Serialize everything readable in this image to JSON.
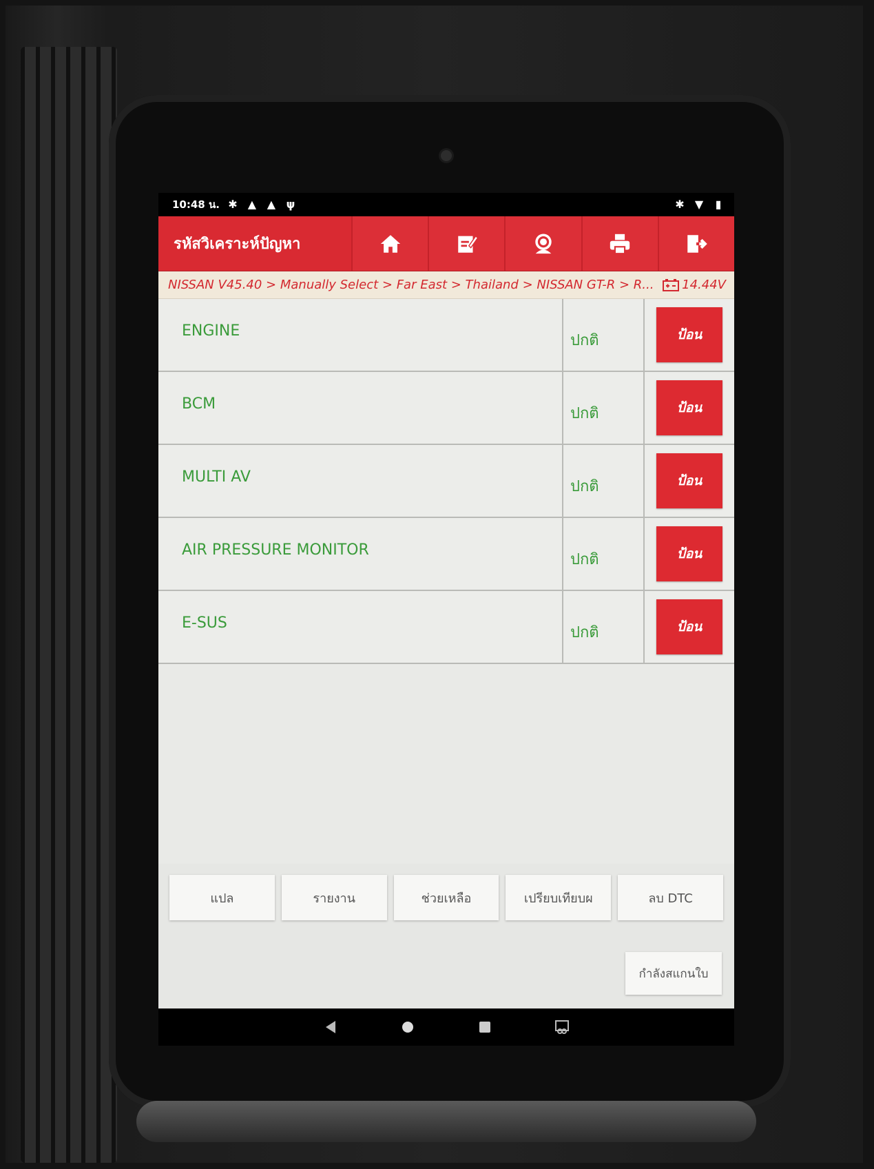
{
  "status_bar": {
    "time": "10:48 น.",
    "icons": [
      "bluetooth-icon",
      "warning-icon",
      "warning-icon",
      "usb-icon",
      "wifi-icon",
      "battery-icon"
    ]
  },
  "header": {
    "title": "รหัสวิเคราะห์ปัญหา",
    "toolbar": [
      "home-icon",
      "edit-icon",
      "support-icon",
      "print-icon",
      "exit-icon"
    ]
  },
  "breadcrumb": {
    "path": "NISSAN V45.40 > Manually Select > Far East > Thailand > NISSAN GT-R > R...",
    "voltage": "14.44V"
  },
  "systems": [
    {
      "name": "ENGINE",
      "status": "ปกติ",
      "action": "ป้อน"
    },
    {
      "name": "BCM",
      "status": "ปกติ",
      "action": "ป้อน"
    },
    {
      "name": "MULTI AV",
      "status": "ปกติ",
      "action": "ป้อน"
    },
    {
      "name": "AIR PRESSURE MONITOR",
      "status": "ปกติ",
      "action": "ป้อน"
    },
    {
      "name": "E-SUS",
      "status": "ปกติ",
      "action": "ป้อน"
    }
  ],
  "footer": {
    "buttons": [
      "แปล",
      "รายงาน",
      "ช่วยเหลือ",
      "เปรียบเทียบผ",
      "ลบ DTC"
    ],
    "scan_label": "กำลังสแกนใบ"
  },
  "colors": {
    "accent": "#d92a32",
    "ok_text": "#3a9b3a",
    "breadcrumb_text": "#d3282f"
  }
}
